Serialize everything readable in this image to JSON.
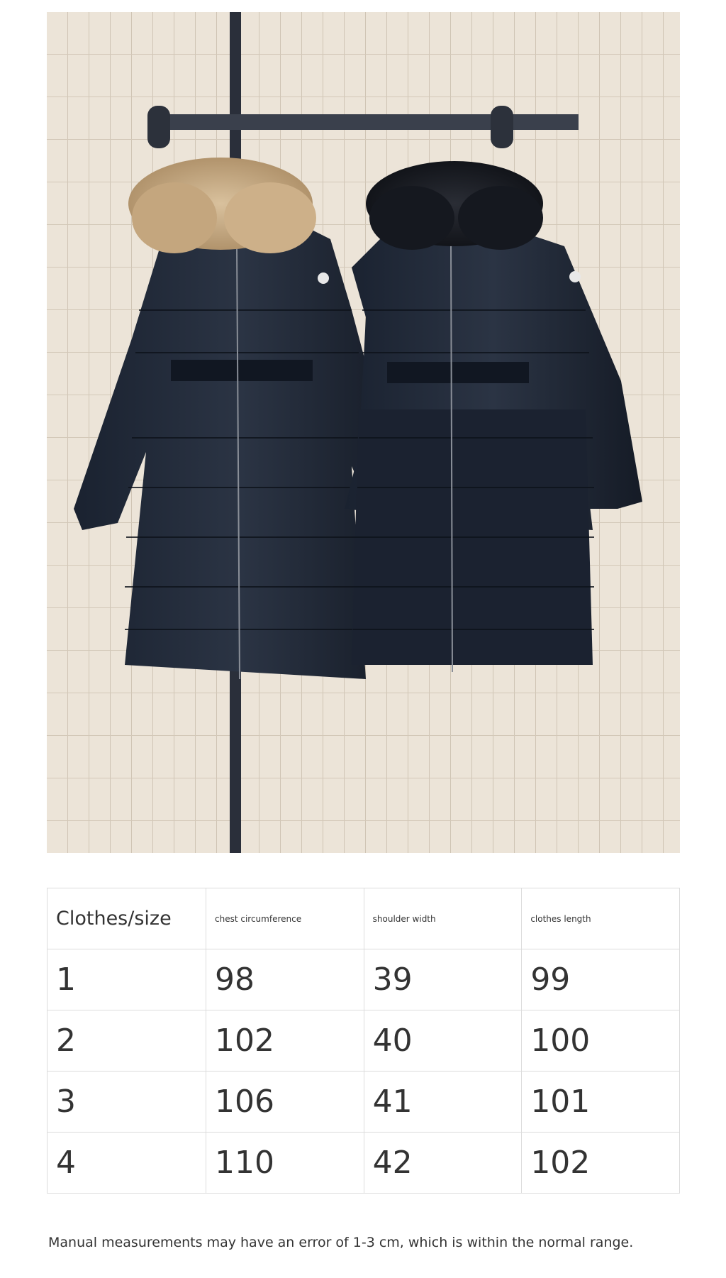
{
  "photo": {
    "subject": "two-black-down-coats-icon"
  },
  "size_table": {
    "headers": [
      "Clothes/size",
      "chest circumference",
      "shoulder width",
      "clothes length"
    ],
    "rows": [
      [
        "1",
        "98",
        "39",
        "99"
      ],
      [
        "2",
        "102",
        "40",
        "100"
      ],
      [
        "3",
        "106",
        "41",
        "101"
      ],
      [
        "4",
        "110",
        "42",
        "102"
      ]
    ]
  },
  "note": "Manual measurements may have an error of 1-3 cm, which is within the normal range."
}
